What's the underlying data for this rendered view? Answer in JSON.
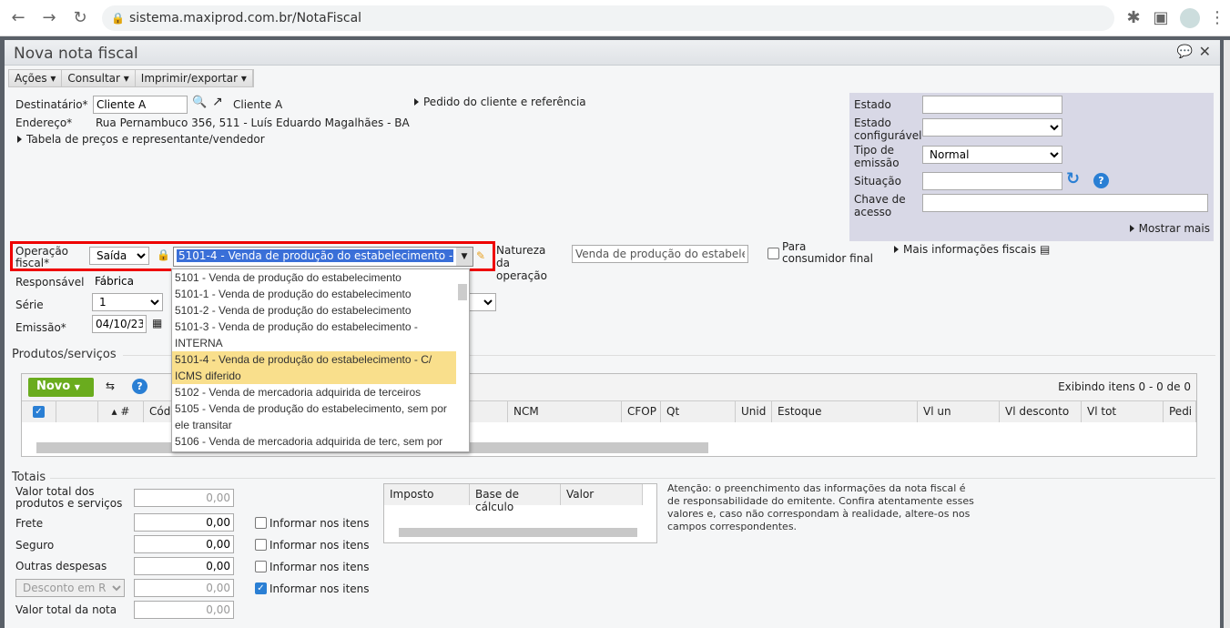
{
  "browser": {
    "url": "sistema.maxiprod.com.br/NotaFiscal"
  },
  "window": {
    "title": "Nova nota fiscal"
  },
  "menu": [
    "Ações",
    "Consultar",
    "Imprimir/exportar"
  ],
  "header": {
    "destinatario_label": "Destinatário*",
    "destinatario_value": "Cliente A",
    "destinatario_link": "Cliente A",
    "endereco_label": "Endereço*",
    "endereco_value": "Rua Pernambuco 356, 511 - Luís Eduardo Magalhães - BA",
    "tabela_link": "Tabela de preços e representante/vendedor",
    "pedido_link": "Pedido do cliente e referência"
  },
  "right_panel": {
    "estado_label": "Estado",
    "estado_value": "",
    "estado_config_label": "Estado configurável",
    "estado_config_value": "",
    "tipo_emissao_label": "Tipo de emissão",
    "tipo_emissao_value": "Normal",
    "situacao_label": "Situação",
    "situacao_value": "",
    "chave_label": "Chave de acesso",
    "chave_value": "",
    "mostrar_mais": "Mostrar mais"
  },
  "operacao": {
    "label": "Operação fiscal*",
    "tipo": "Saída",
    "selected": "5101-4 - Venda de produção do estabelecimento - C/ ICMS diferido",
    "natureza_label": "Natureza da operação",
    "natureza_value": "Venda de produção do estabelecimento",
    "consumidor_label": "Para consumidor final",
    "mais_info": "Mais informações fiscais",
    "options": [
      "5101 - Venda de produção do estabelecimento",
      "5101-1 - Venda de produção do estabelecimento",
      "5101-2 - Venda de produção do estabelecimento",
      "5101-3 - Venda de produção do estabelecimento - INTERNA",
      "5101-4 - Venda de produção do estabelecimento - C/ ICMS diferido",
      "5102 - Venda de mercadoria adquirida de terceiros",
      "5105 - Venda de produção do estabelecimento, sem por ele transitar",
      "5106 - Venda de mercadoria adquirida de terc, sem por"
    ]
  },
  "fields": {
    "responsavel_label": "Responsável",
    "responsavel_value": "Fábrica",
    "serie_label": "Série",
    "serie_value": "1",
    "emissao_label": "Emissão*",
    "emissao_value": "04/10/23"
  },
  "produtos": {
    "title": "Produtos/serviços",
    "novo": "Novo",
    "exibindo": "Exibindo itens 0 - 0 de 0",
    "columns": [
      "#",
      "Códi",
      "NCM",
      "CFOP",
      "Qt",
      "Unid",
      "Estoque",
      "Vl un",
      "Vl desconto",
      "Vl tot",
      "Pedi"
    ]
  },
  "totais": {
    "title": "Totais",
    "rows": [
      {
        "label": "Valor total dos produtos e serviços",
        "value": "0,00"
      },
      {
        "label": "Frete",
        "value": "0,00",
        "informar": "Informar nos itens",
        "checked": false
      },
      {
        "label": "Seguro",
        "value": "0,00",
        "informar": "Informar nos itens",
        "checked": false
      },
      {
        "label": "Outras despesas",
        "value": "0,00",
        "informar": "Informar nos itens",
        "checked": false
      },
      {
        "label": "Desconto em R$",
        "value": "0,00",
        "informar": "Informar nos itens",
        "checked": true
      },
      {
        "label": "Valor total da nota",
        "value": "0,00"
      }
    ],
    "imposto_columns": [
      "Imposto",
      "Base de cálculo",
      "Valor"
    ],
    "atencao": "Atenção: o preenchimento das informações da nota fiscal é de responsabilidade do emitente. Confira atentamente esses valores e, caso não correspondam à realidade, altere-os nos campos correspondentes."
  }
}
